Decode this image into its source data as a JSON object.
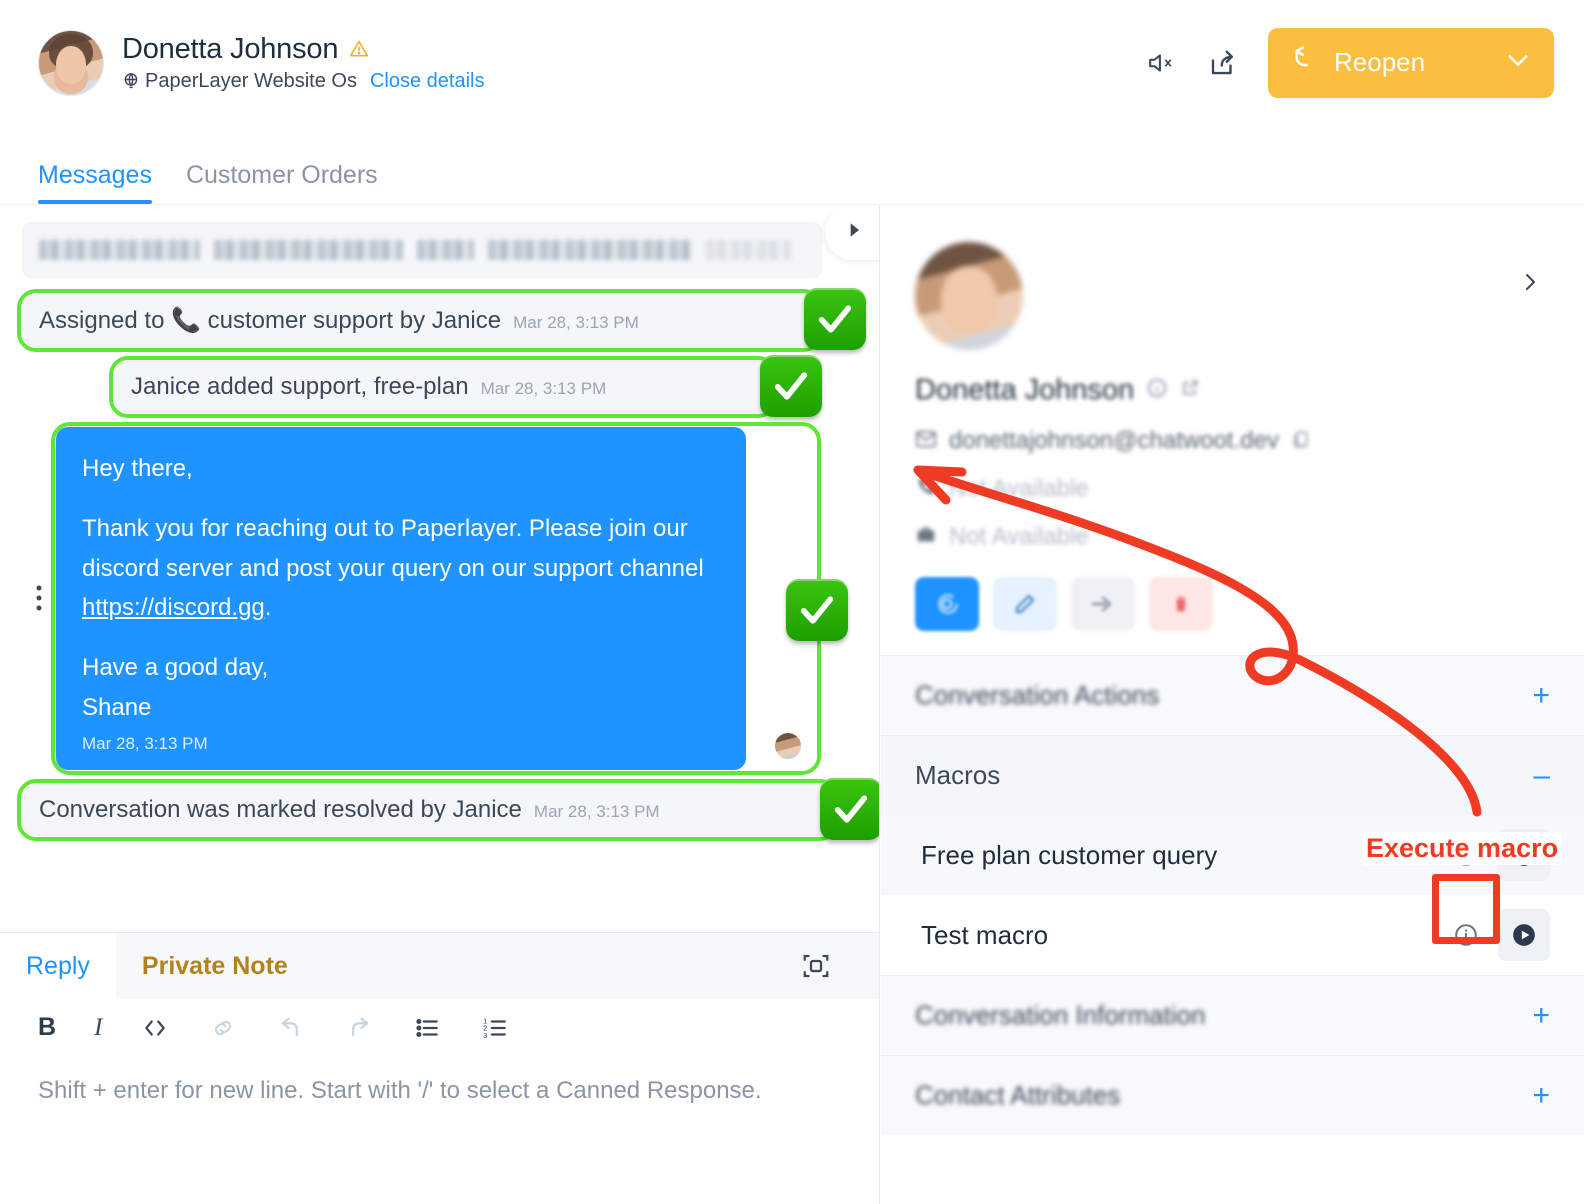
{
  "header": {
    "contact_name": "Donetta Johnson",
    "warning_icon": "warning-triangle-icon",
    "inbox_name": "PaperLayer Website Os",
    "inbox_icon": "globe-icon",
    "close_details_label": "Close details",
    "mute_icon": "mute-speaker-icon",
    "share_icon": "share-arrow-icon",
    "reopen_label": "Reopen",
    "reopen_icon": "reopen-arrow-icon",
    "reopen_chevron": "chevron-down-icon",
    "reopen_color": "#fbbe3e",
    "accent_color": "#1f93ff"
  },
  "tabs": [
    {
      "label": "Messages",
      "active": true
    },
    {
      "label": "Customer Orders",
      "active": false
    }
  ],
  "messages": {
    "scroll_icon": "play-triangle-icon",
    "redacted_first_message": true,
    "items": [
      {
        "type": "system",
        "text": "Assigned to 📞 customer support by Janice",
        "time": "Mar 28, 3:13 PM",
        "annotated": true
      },
      {
        "type": "system",
        "text": "Janice added support, free-plan",
        "time": "Mar 28, 3:13 PM",
        "annotated": true
      },
      {
        "type": "agent",
        "paragraphs": [
          "Hey there,",
          "Thank you for reaching out to Paperlayer. Please join our discord server and post your query on our support channel ",
          "Have a good day,"
        ],
        "link_text": "https://discord.gg",
        "link_suffix": ".",
        "signature": "Shane",
        "time": "Mar 28, 3:13 PM",
        "annotated": true,
        "bubble_color": "#1f93ff"
      },
      {
        "type": "system",
        "text": "Conversation was marked resolved by Janice",
        "time": "Mar 28, 3:13 PM",
        "annotated": true
      }
    ]
  },
  "reply_box": {
    "tabs": [
      {
        "label": "Reply",
        "active": true
      },
      {
        "label": "Private Note",
        "active": false
      }
    ],
    "expand_icon": "expand-fullscreen-icon",
    "toolbar": [
      {
        "name": "bold-icon",
        "glyph": "B"
      },
      {
        "name": "italic-icon",
        "glyph": "I"
      },
      {
        "name": "code-icon",
        "glyph": "</>"
      },
      {
        "name": "link-icon",
        "glyph": "link"
      },
      {
        "name": "undo-icon",
        "glyph": "undo"
      },
      {
        "name": "redo-icon",
        "glyph": "redo"
      },
      {
        "name": "bullet-list-icon",
        "glyph": "bullets"
      },
      {
        "name": "ordered-list-icon",
        "glyph": "numbers"
      }
    ],
    "placeholder": "Shift + enter for new line. Start with '/' to select a Canned Response."
  },
  "sidebar": {
    "contact_name": "Donetta Johnson",
    "contact_name_icons": [
      "info-circle-icon",
      "external-link-icon"
    ],
    "email": "donettajohnson@chatwoot.dev",
    "email_icon": "mail-icon",
    "copy_icon": "copy-icon",
    "phone": "Not Available",
    "phone_icon": "phone-icon",
    "company": "Not Available",
    "company_icon": "briefcase-icon",
    "expand_chevron": "chevron-right-icon",
    "actions": [
      {
        "name": "message-action-button",
        "icon": "chat-icon",
        "style": "primary"
      },
      {
        "name": "edit-action-button",
        "icon": "pencil-icon",
        "style": "soft-blue"
      },
      {
        "name": "merge-action-button",
        "icon": "merge-icon",
        "style": "soft-grey"
      },
      {
        "name": "delete-action-button",
        "icon": "trash-icon",
        "style": "soft-red"
      }
    ],
    "sections": [
      {
        "label": "Conversation Actions",
        "expanded": false,
        "toggle": "+",
        "blurred": true
      },
      {
        "label": "Macros",
        "expanded": true,
        "toggle": "–",
        "blurred": false
      }
    ],
    "macros": [
      {
        "name": "Free plan customer query",
        "info_icon": "info-circle-icon",
        "play_icon": "play-circle-icon",
        "highlighted": true
      },
      {
        "name": "Test macro",
        "info_icon": "info-circle-icon",
        "play_icon": "play-circle-icon",
        "highlighted": false
      }
    ],
    "bottom_sections": [
      {
        "label": "Conversation Information",
        "toggle": "+",
        "blurred": true
      },
      {
        "label": "Contact Attributes",
        "toggle": "+",
        "blurred": true
      }
    ]
  },
  "annotations": {
    "execute_macro_label": "Execute macro",
    "annotation_color": "#ef3b23",
    "highlight_color": "#5fe636"
  }
}
